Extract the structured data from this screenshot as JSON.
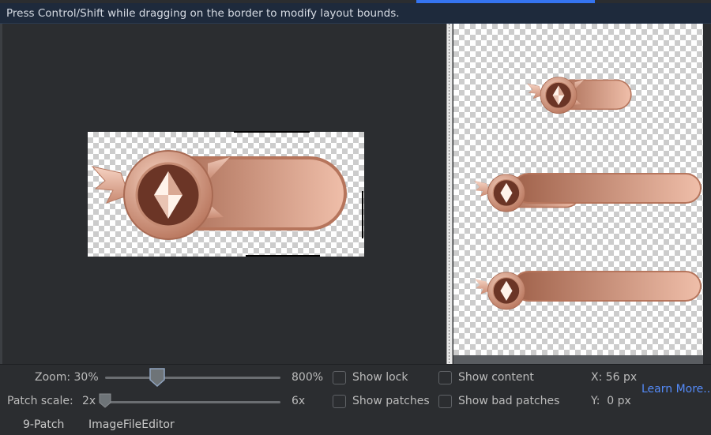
{
  "hint": {
    "text": "Press Control/Shift while dragging on the border to modify layout bounds."
  },
  "controls": {
    "zoom_label": "Zoom: 30%",
    "zoom_max": "800%",
    "patch_scale_label": "Patch scale:",
    "patch_scale_min": "2x",
    "patch_scale_max": "6x",
    "show_lock": "Show lock",
    "show_patches": "Show patches",
    "show_content": "Show content",
    "show_bad_patches": "Show bad patches",
    "x_readout": "X: 56 px",
    "y_readout": "Y:  0 px",
    "learn_more": "Learn More...",
    "zoom_level": 0.3,
    "patch_scale_level": 0.0
  },
  "tabs": {
    "nine_patch": "9-Patch",
    "image_file_editor": "ImageFileEditor"
  },
  "colors": {
    "accent": "#3574f0",
    "link": "#548af7",
    "panel": "#2b2d30",
    "hint_bg": "#1e2a3c"
  },
  "icons": {
    "preview_badge": "diamond-badge-icon"
  }
}
